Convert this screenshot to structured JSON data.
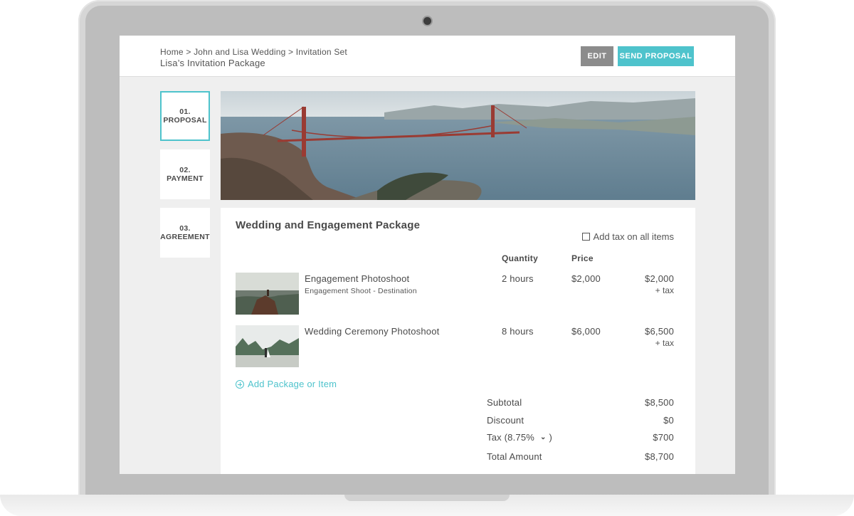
{
  "header": {
    "breadcrumb": "Home > John and Lisa Wedding > Invitation Set",
    "title": "Lisa’s Invitation Package",
    "edit_label": "EDIT",
    "send_label": "SEND PROPOSAL"
  },
  "steps": [
    {
      "num": "01.",
      "label": "PROPOSAL",
      "active": true
    },
    {
      "num": "02.",
      "label": "PAYMENT",
      "active": false
    },
    {
      "num": "03.",
      "label": "AGREEMENT",
      "active": false
    }
  ],
  "package": {
    "title": "Wedding and Engagement Package",
    "tax_all_label": "Add tax on all items",
    "col_quantity": "Quantity",
    "col_price": "Price",
    "items": [
      {
        "name": "Engagement Photoshoot",
        "subtitle": "Engagement Shoot - Destination",
        "quantity": "2 hours",
        "price": "$2,000",
        "total": "$2,000",
        "tax_note": "+ tax"
      },
      {
        "name": "Wedding Ceremony Photoshoot",
        "subtitle": "",
        "quantity": "8 hours",
        "price": "$6,000",
        "total": "$6,500",
        "tax_note": "+ tax"
      }
    ],
    "add_label": "Add Package or Item"
  },
  "summary": {
    "subtotal_label": "Subtotal",
    "subtotal": "$8,500",
    "discount_label": "Discount",
    "discount": "$0",
    "tax_label_prefix": "Tax (8.75%",
    "tax_label_suffix": ")",
    "tax": "$700",
    "total_label": "Total Amount",
    "total": "$8,700"
  },
  "colors": {
    "accent": "#4ec3cc",
    "edit_button": "#8c8c8c"
  }
}
